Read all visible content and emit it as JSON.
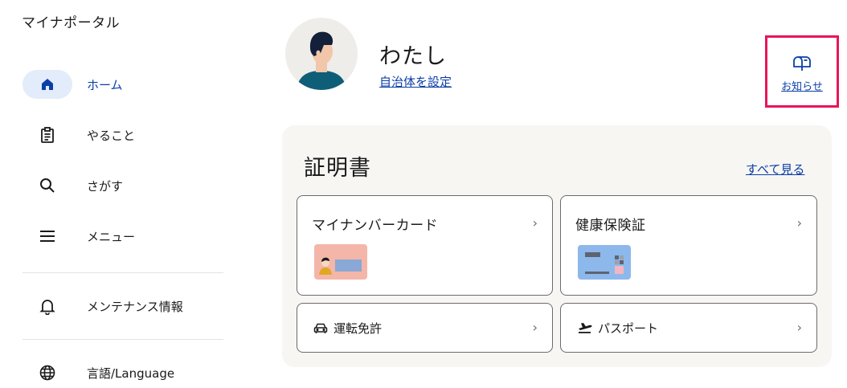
{
  "app": {
    "title": "マイナポータル"
  },
  "sidebar": {
    "items": [
      {
        "label": "ホーム",
        "icon": "home-icon",
        "active": true
      },
      {
        "label": "やること",
        "icon": "clipboard-icon"
      },
      {
        "label": "さがす",
        "icon": "search-icon"
      },
      {
        "label": "メニュー",
        "icon": "menu-icon"
      },
      {
        "label": "メンテナンス情報",
        "icon": "bell-icon"
      },
      {
        "label": "言語/Language",
        "icon": "globe-icon"
      }
    ]
  },
  "profile": {
    "name": "わたし",
    "municipality_link": "自治体を設定"
  },
  "notice": {
    "label": "お知らせ",
    "icon": "mailbox-icon"
  },
  "certificates": {
    "title": "証明書",
    "see_all": "すべて見る",
    "cards": [
      {
        "label": "マイナンバーカード",
        "icon": "mynumber-card-illustration"
      },
      {
        "label": "健康保険証",
        "icon": "health-insurance-card-illustration"
      },
      {
        "label": "運転免許",
        "icon": "car-icon"
      },
      {
        "label": "パスポート",
        "icon": "airplane-icon"
      }
    ]
  },
  "colors": {
    "accent": "#0b3ea8",
    "active_bg": "#e2ecfa",
    "highlight_border": "#e8155a",
    "panel_bg": "#f7f6f3",
    "mynumber_card": "#f4b6a8",
    "insurance_card": "#8db8ec"
  }
}
